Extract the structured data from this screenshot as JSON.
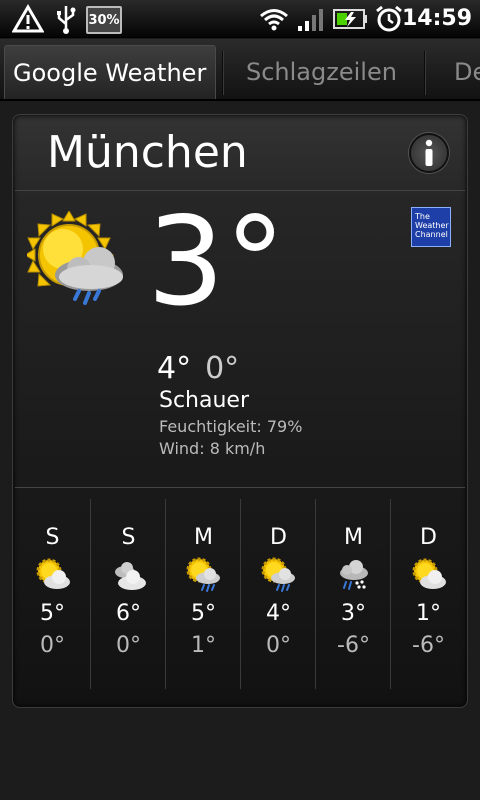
{
  "status_bar": {
    "battery_percent": "30%",
    "time": "14:59",
    "icons": [
      "warning-icon",
      "usb-icon",
      "wifi-icon",
      "signal-icon",
      "battery-charging-icon",
      "alarm-icon"
    ]
  },
  "tabs": [
    {
      "label": "Google Weather",
      "active": true
    },
    {
      "label": "Schlagzeilen",
      "active": false
    },
    {
      "label": "De",
      "active": false
    }
  ],
  "current": {
    "city": "München",
    "temp": "3°",
    "high": "4°",
    "low": "0°",
    "condition": "Schauer",
    "humidity": "Feuchtigkeit: 79%",
    "wind": "Wind: 8 km/h",
    "icon": "sun-cloud-rain-icon",
    "provider_logo": [
      "The",
      "Weather",
      "Channel"
    ]
  },
  "forecast": [
    {
      "day": "S",
      "high": "5°",
      "low": "0°",
      "icon": "partly-sunny-icon"
    },
    {
      "day": "S",
      "high": "6°",
      "low": "0°",
      "icon": "cloudy-icon"
    },
    {
      "day": "M",
      "high": "5°",
      "low": "1°",
      "icon": "sun-cloud-rain-icon"
    },
    {
      "day": "D",
      "high": "4°",
      "low": "0°",
      "icon": "sun-cloud-rain-icon"
    },
    {
      "day": "M",
      "high": "3°",
      "low": "-6°",
      "icon": "cloud-snow-rain-icon"
    },
    {
      "day": "D",
      "high": "1°",
      "low": "-6°",
      "icon": "partly-sunny-icon"
    }
  ],
  "colors": {
    "sun": "#f5c400",
    "cloud": "#dcdcdc",
    "rain": "#3a78d8",
    "provider_blue": "#1f3fa8"
  }
}
